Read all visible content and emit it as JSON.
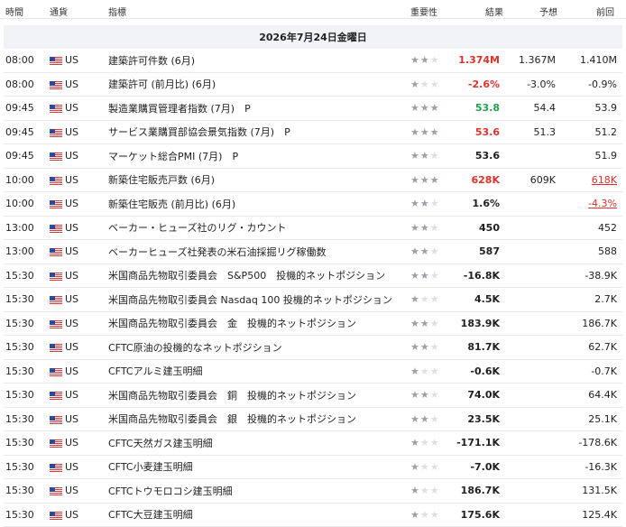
{
  "header": {
    "time": "時間",
    "currency": "通貨",
    "indicator": "指標",
    "importance": "重要性",
    "actual": "結果",
    "forecast": "予想",
    "previous": "前回"
  },
  "date_label": "2026年7月24日金曜日",
  "colors": {
    "up": "#21a14b",
    "down": "#e0322b",
    "star_on": "#9aa0a8",
    "star_off": "#dcdfe3",
    "date_bg": "#f1f3f6"
  },
  "rows": [
    {
      "time": "08:00",
      "currency": "US",
      "name": "建築許可件数 (6月)",
      "stars": 2,
      "actual": "1.374M",
      "actual_color": "red",
      "forecast": "1.367M",
      "previous": "1.410M",
      "previous_style": ""
    },
    {
      "time": "08:00",
      "currency": "US",
      "name": "建築許可 (前月比) (6月)",
      "stars": 1,
      "actual": "-2.6%",
      "actual_color": "red",
      "forecast": "-3.0%",
      "previous": "-0.9%",
      "previous_style": ""
    },
    {
      "time": "09:45",
      "currency": "US",
      "name": "製造業購買管理者指数 (7月)　P",
      "stars": 3,
      "actual": "53.8",
      "actual_color": "green",
      "forecast": "54.4",
      "previous": "53.9",
      "previous_style": ""
    },
    {
      "time": "09:45",
      "currency": "US",
      "name": "サービス業購買部協会景気指数 (7月)　P",
      "stars": 3,
      "actual": "53.6",
      "actual_color": "red",
      "forecast": "51.3",
      "previous": "51.2",
      "previous_style": ""
    },
    {
      "time": "09:45",
      "currency": "US",
      "name": "マーケット総合PMI (7月)　P",
      "stars": 2,
      "actual": "53.6",
      "actual_color": "",
      "forecast": "",
      "previous": "51.9",
      "previous_style": ""
    },
    {
      "time": "10:00",
      "currency": "US",
      "name": "新築住宅販売戸数 (6月)",
      "stars": 3,
      "actual": "628K",
      "actual_color": "red",
      "forecast": "609K",
      "previous": "618K",
      "previous_style": "red-under"
    },
    {
      "time": "10:00",
      "currency": "US",
      "name": "新築住宅販売 (前月比) (6月)",
      "stars": 2,
      "actual": "1.6%",
      "actual_color": "",
      "forecast": "",
      "previous": "-4.3%",
      "previous_style": "red-under"
    },
    {
      "time": "13:00",
      "currency": "US",
      "name": "ベーカー・ヒューズ社のリグ・カウント",
      "stars": 2,
      "actual": "450",
      "actual_color": "",
      "forecast": "",
      "previous": "452",
      "previous_style": ""
    },
    {
      "time": "13:00",
      "currency": "US",
      "name": "ベーカーヒューズ社発表の米石油採掘リグ稼働数",
      "stars": 2,
      "actual": "587",
      "actual_color": "",
      "forecast": "",
      "previous": "588",
      "previous_style": ""
    },
    {
      "time": "15:30",
      "currency": "US",
      "name": "米国商品先物取引委員会　S&P500　投機的ネットポジション",
      "stars": 2,
      "actual": "-16.8K",
      "actual_color": "",
      "forecast": "",
      "previous": "-38.9K",
      "previous_style": ""
    },
    {
      "time": "15:30",
      "currency": "US",
      "name": "米国商品先物取引委員会 Nasdaq 100 投機的ネットポジション",
      "stars": 1,
      "actual": "4.5K",
      "actual_color": "",
      "forecast": "",
      "previous": "2.7K",
      "previous_style": ""
    },
    {
      "time": "15:30",
      "currency": "US",
      "name": "米国商品先物取引委員会　金　投機的ネットポジション",
      "stars": 2,
      "actual": "183.9K",
      "actual_color": "",
      "forecast": "",
      "previous": "186.7K",
      "previous_style": ""
    },
    {
      "time": "15:30",
      "currency": "US",
      "name": "CFTC原油の投機的なネットポジション",
      "stars": 2,
      "actual": "81.7K",
      "actual_color": "",
      "forecast": "",
      "previous": "62.7K",
      "previous_style": ""
    },
    {
      "time": "15:30",
      "currency": "US",
      "name": "CFTCアルミ建玉明細",
      "stars": 1,
      "actual": "-0.6K",
      "actual_color": "",
      "forecast": "",
      "previous": "-0.7K",
      "previous_style": ""
    },
    {
      "time": "15:30",
      "currency": "US",
      "name": "米国商品先物取引委員会　銅　投機的ネットポジション",
      "stars": 2,
      "actual": "74.0K",
      "actual_color": "",
      "forecast": "",
      "previous": "64.4K",
      "previous_style": ""
    },
    {
      "time": "15:30",
      "currency": "US",
      "name": "米国商品先物取引委員会　銀　投機的ネットポジション",
      "stars": 2,
      "actual": "23.5K",
      "actual_color": "",
      "forecast": "",
      "previous": "25.1K",
      "previous_style": ""
    },
    {
      "time": "15:30",
      "currency": "US",
      "name": "CFTC天然ガス建玉明細",
      "stars": 1,
      "actual": "-171.1K",
      "actual_color": "",
      "forecast": "",
      "previous": "-178.6K",
      "previous_style": ""
    },
    {
      "time": "15:30",
      "currency": "US",
      "name": "CFTC小麦建玉明細",
      "stars": 1,
      "actual": "-7.0K",
      "actual_color": "",
      "forecast": "",
      "previous": "-16.3K",
      "previous_style": ""
    },
    {
      "time": "15:30",
      "currency": "US",
      "name": "CFTCトウモロコシ建玉明細",
      "stars": 1,
      "actual": "186.7K",
      "actual_color": "",
      "forecast": "",
      "previous": "131.5K",
      "previous_style": ""
    },
    {
      "time": "15:30",
      "currency": "US",
      "name": "CFTC大豆建玉明細",
      "stars": 1,
      "actual": "175.6K",
      "actual_color": "",
      "forecast": "",
      "previous": "125.4K",
      "previous_style": ""
    }
  ]
}
